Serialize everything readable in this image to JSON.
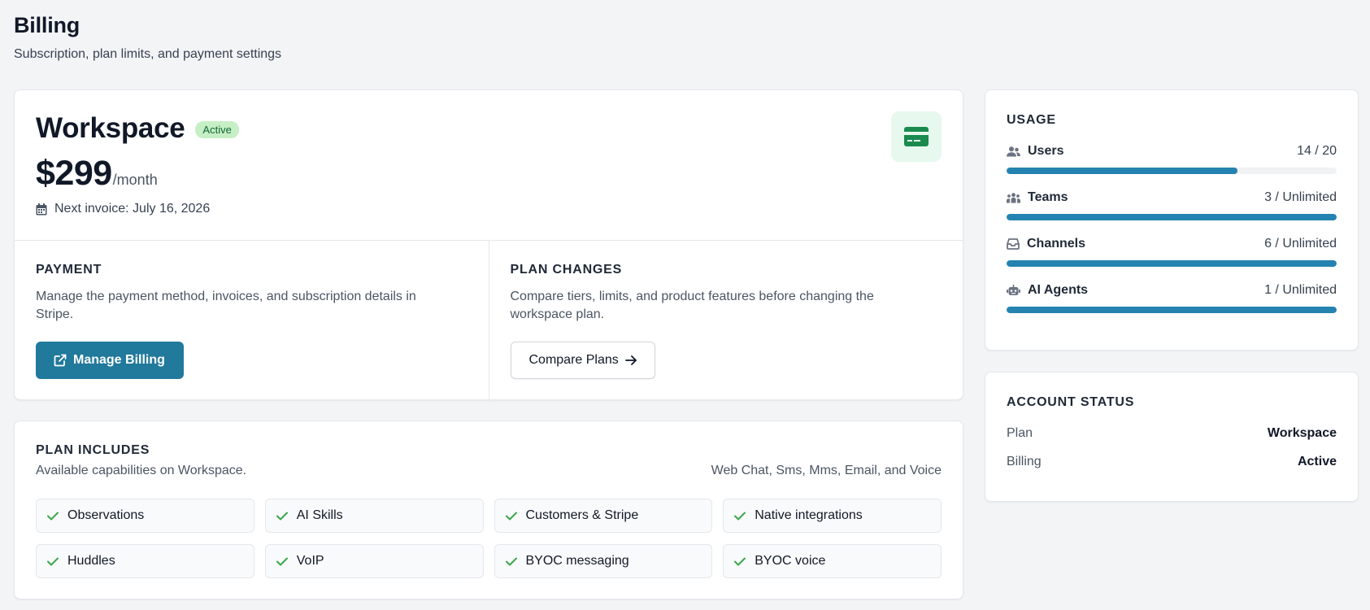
{
  "header": {
    "title": "Billing",
    "subtitle": "Subscription, plan limits, and payment settings"
  },
  "plan": {
    "name": "Workspace",
    "status_badge": "Active",
    "price": "$299",
    "price_unit": "/month",
    "next_invoice": "Next invoice: July 16, 2026",
    "icon": "credit-card-icon",
    "accent_color": "#1a8a4f"
  },
  "payment": {
    "label": "PAYMENT",
    "description": "Manage the payment method, invoices, and subscription details in Stripe.",
    "button_label": "Manage Billing",
    "button_color": "#21799c"
  },
  "plan_changes": {
    "label": "PLAN CHANGES",
    "description": "Compare tiers, limits, and product features before changing the workspace plan.",
    "button_label": "Compare Plans"
  },
  "includes": {
    "label": "PLAN INCLUDES",
    "subtitle": "Available capabilities on Workspace.",
    "channels": "Web Chat, Sms, Mms, Email, and Voice",
    "features": [
      "Observations",
      "AI Skills",
      "Customers & Stripe",
      "Native integrations",
      "Huddles",
      "VoIP",
      "BYOC messaging",
      "BYOC voice"
    ],
    "check_color": "#3aa64a"
  },
  "usage": {
    "label": "USAGE",
    "bar_color": "#2483b0",
    "items": [
      {
        "label": "Users",
        "value": "14 / 20",
        "fraction": 0.7,
        "icon": "users-icon"
      },
      {
        "label": "Teams",
        "value": "3 / Unlimited",
        "fraction": 1.0,
        "icon": "teams-icon"
      },
      {
        "label": "Channels",
        "value": "6 / Unlimited",
        "fraction": 1.0,
        "icon": "inbox-icon"
      },
      {
        "label": "AI Agents",
        "value": "1 / Unlimited",
        "fraction": 1.0,
        "icon": "robot-icon"
      }
    ]
  },
  "account_status": {
    "label": "ACCOUNT STATUS",
    "rows": [
      {
        "label": "Plan",
        "value": "Workspace"
      },
      {
        "label": "Billing",
        "value": "Active"
      }
    ]
  }
}
